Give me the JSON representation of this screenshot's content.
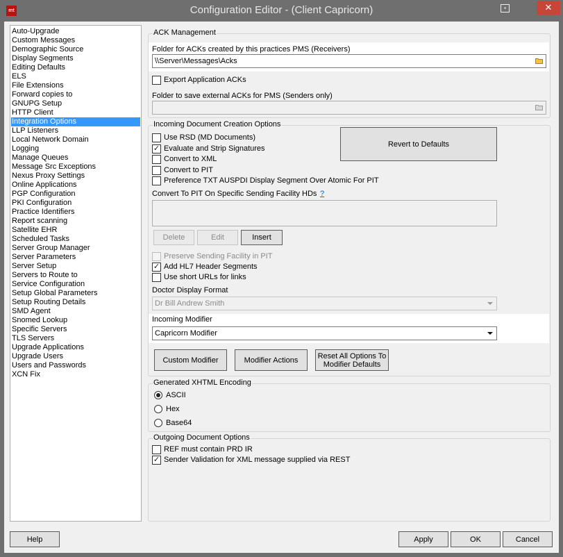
{
  "window": {
    "title": "Configuration Editor -  (Client Capricorn)",
    "app_icon_text": "mt"
  },
  "nav": {
    "items": [
      "Auto-Upgrade",
      "Custom Messages",
      "Demographic Source",
      "Display Segments",
      "Editing Defaults",
      "ELS",
      "File Extensions",
      "Forward copies to",
      "GNUPG Setup",
      "HTTP Client",
      "Integration Options",
      "LLP Listeners",
      "Local Network Domain",
      "Logging",
      "Manage Queues",
      "Message Src Exceptions",
      "Nexus Proxy Settings",
      "Online Applications",
      "PGP Configuration",
      "PKI Configuration",
      "Practice Identifiers",
      "Report scanning",
      "Satellite EHR",
      "Scheduled Tasks",
      "Server Group Manager",
      "Server Parameters",
      "Server Setup",
      "Servers to Route to",
      "Service Configuration",
      "Setup Global Parameters",
      "Setup Routing Details",
      "SMD Agent",
      "Snomed Lookup",
      "Specific Servers",
      "TLS Servers",
      "Upgrade Applications",
      "Upgrade Users",
      "Users and Passwords",
      "XCN Fix"
    ],
    "selected": "Integration Options"
  },
  "ack": {
    "group_title": "ACK Management",
    "folder_label": "Folder for ACKs created by this practices PMS (Receivers)",
    "folder_value": "\\\\Server\\Messages\\Acks",
    "export_label": "Export Application ACKs",
    "export_checked": false,
    "external_label": "Folder to save external ACKs for PMS (Senders only)",
    "external_value": ""
  },
  "incoming": {
    "group_title": "Incoming Document Creation Options",
    "checkboxes": [
      {
        "label": "Use RSD (MD Documents)",
        "checked": false
      },
      {
        "label": "Evaluate and Strip Signatures",
        "checked": true
      },
      {
        "label": "Convert to XML",
        "checked": false
      },
      {
        "label": "Convert to PIT",
        "checked": false
      },
      {
        "label": "Preference TXT AUSPDI Display Segment Over Atomic For PIT",
        "checked": false
      }
    ],
    "revert_label": "Revert to Defaults",
    "pit_label": "Convert To PIT On Specific Sending Facility HDs",
    "pit_help": "?",
    "delete_label": "Delete",
    "edit_label": "Edit",
    "insert_label": "Insert",
    "preserve_label": "Preserve Sending Facility in PIT",
    "preserve_checked": false,
    "hl7_label": "Add HL7 Header Segments",
    "hl7_checked": true,
    "short_urls_label": "Use short URLs for links",
    "short_urls_checked": false,
    "doctor_label": "Doctor Display Format",
    "doctor_value": "Dr Bill Andrew Smith",
    "modifier_label": "Incoming Modifier",
    "modifier_value": "Capricorn Modifier",
    "custom_modifier_label": "Custom Modifier",
    "modifier_actions_label": "Modifier Actions",
    "reset_line1": "Reset All Options To",
    "reset_line2": "Modifier Defaults"
  },
  "xhtml": {
    "group_title": "Generated XHTML Encoding",
    "options": [
      {
        "label": "ASCII",
        "selected": true
      },
      {
        "label": "Hex",
        "selected": false
      },
      {
        "label": "Base64",
        "selected": false
      }
    ]
  },
  "outgoing": {
    "group_title": "Outgoing Document Options",
    "checkboxes": [
      {
        "label": "REF must contain PRD IR",
        "checked": false
      },
      {
        "label": "Sender Validation for XML message supplied via REST",
        "checked": true
      }
    ]
  },
  "footer": {
    "help_label": "Help",
    "apply_label": "Apply",
    "ok_label": "OK",
    "cancel_label": "Cancel"
  },
  "icons": {
    "close": "close-icon",
    "folder": "folder-icon",
    "help": "help-window-icon"
  }
}
